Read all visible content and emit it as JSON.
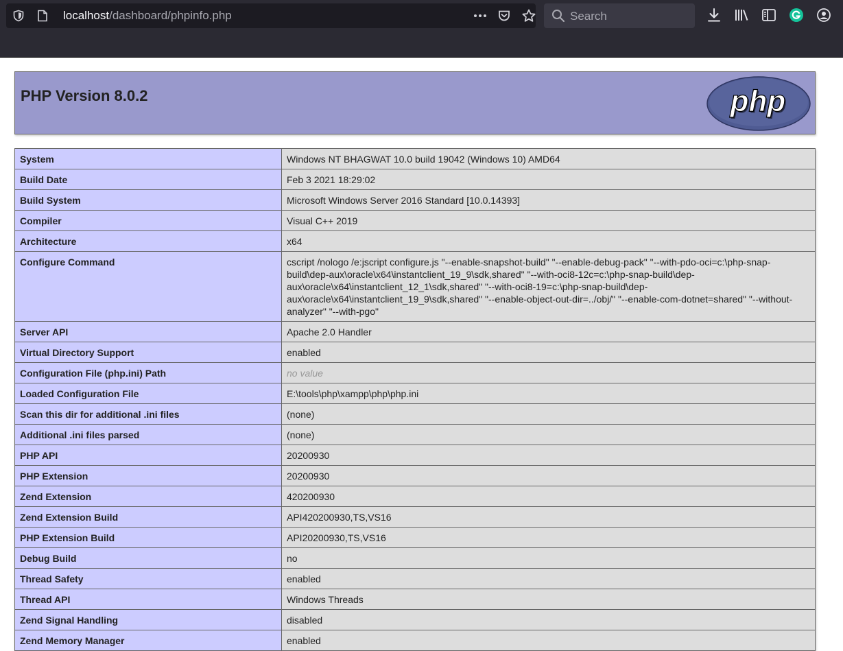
{
  "browser": {
    "url_host": "localhost",
    "url_path": "/dashboard/phpinfo.php",
    "search_placeholder": "Search"
  },
  "page": {
    "title": "PHP Version 8.0.2",
    "logo_text": "php"
  },
  "rows": [
    {
      "key": "System",
      "value": "Windows NT BHAGWAT 10.0 build 19042 (Windows 10) AMD64"
    },
    {
      "key": "Build Date",
      "value": "Feb 3 2021 18:29:02"
    },
    {
      "key": "Build System",
      "value": "Microsoft Windows Server 2016 Standard [10.0.14393]"
    },
    {
      "key": "Compiler",
      "value": "Visual C++ 2019"
    },
    {
      "key": "Architecture",
      "value": "x64"
    },
    {
      "key": "Configure Command",
      "value": "cscript /nologo /e:jscript configure.js \"--enable-snapshot-build\" \"--enable-debug-pack\" \"--with-pdo-oci=c:\\php-snap-build\\dep-aux\\oracle\\x64\\instantclient_19_9\\sdk,shared\" \"--with-oci8-12c=c:\\php-snap-build\\dep-aux\\oracle\\x64\\instantclient_12_1\\sdk,shared\" \"--with-oci8-19=c:\\php-snap-build\\dep-aux\\oracle\\x64\\instantclient_19_9\\sdk,shared\" \"--enable-object-out-dir=../obj/\" \"--enable-com-dotnet=shared\" \"--without-analyzer\" \"--with-pgo\""
    },
    {
      "key": "Server API",
      "value": "Apache 2.0 Handler"
    },
    {
      "key": "Virtual Directory Support",
      "value": "enabled"
    },
    {
      "key": "Configuration File (php.ini) Path",
      "value": "no value",
      "novalue": true
    },
    {
      "key": "Loaded Configuration File",
      "value": "E:\\tools\\php\\xampp\\php\\php.ini"
    },
    {
      "key": "Scan this dir for additional .ini files",
      "value": "(none)"
    },
    {
      "key": "Additional .ini files parsed",
      "value": "(none)"
    },
    {
      "key": "PHP API",
      "value": "20200930"
    },
    {
      "key": "PHP Extension",
      "value": "20200930"
    },
    {
      "key": "Zend Extension",
      "value": "420200930"
    },
    {
      "key": "Zend Extension Build",
      "value": "API420200930,TS,VS16"
    },
    {
      "key": "PHP Extension Build",
      "value": "API20200930,TS,VS16"
    },
    {
      "key": "Debug Build",
      "value": "no"
    },
    {
      "key": "Thread Safety",
      "value": "enabled"
    },
    {
      "key": "Thread API",
      "value": "Windows Threads"
    },
    {
      "key": "Zend Signal Handling",
      "value": "disabled"
    },
    {
      "key": "Zend Memory Manager",
      "value": "enabled"
    }
  ]
}
